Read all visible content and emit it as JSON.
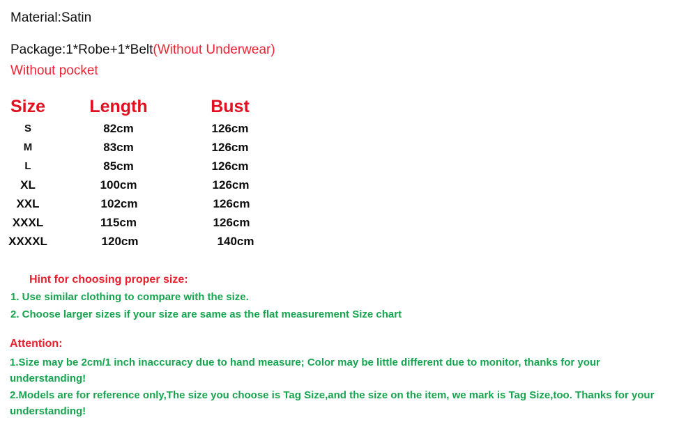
{
  "colors": {
    "red": "#ee2233",
    "header_red": "#e01020",
    "green": "#17a44f",
    "black": "#111111",
    "background": "#ffffff"
  },
  "intro": {
    "material_line": "Material:Satin",
    "package_label": "Package:1*Robe+1*Belt",
    "package_note": "(Without Underwear)",
    "pocket_note": "Without pocket"
  },
  "size_chart": {
    "headers": [
      "Size",
      "Length",
      "Bust"
    ],
    "rows": [
      {
        "size": "S",
        "length": "82cm",
        "bust": "126cm"
      },
      {
        "size": "M",
        "length": "83cm",
        "bust": "126cm"
      },
      {
        "size": "L",
        "length": "85cm",
        "bust": "126cm"
      },
      {
        "size": "XL",
        "length": "100cm",
        "bust": "126cm"
      },
      {
        "size": "XXL",
        "length": "102cm",
        "bust": "126cm"
      },
      {
        "size": "XXXL",
        "length": "115cm",
        "bust": "126cm"
      },
      {
        "size": "XXXXL",
        "length": "120cm",
        "bust": "140cm"
      }
    ]
  },
  "hint": {
    "title": "Hint for choosing proper size:",
    "items": [
      "1. Use similar clothing to compare with the size.",
      "2. Choose larger sizes if your size are same as the flat measurement Size chart"
    ]
  },
  "attention": {
    "title": "Attention:",
    "items": [
      "1.Size may be 2cm/1 inch inaccuracy due to hand measure; Color may be little different   due to monitor, thanks for your understanding!",
      "2.Models are for reference only,The size you choose is Tag Size,and the size on the item,  we mark is Tag Size,too. Thanks for your understanding!"
    ]
  }
}
